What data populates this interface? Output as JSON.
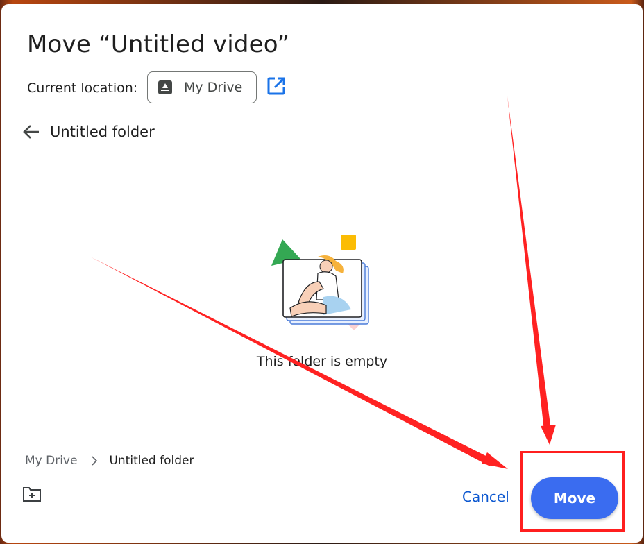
{
  "dialog": {
    "title": "Move “Untitled video”",
    "current_location_label": "Current location:",
    "current_location_value": "My Drive",
    "current_folder": "Untitled folder",
    "empty_message": "This folder is empty"
  },
  "breadcrumb": {
    "root": "My Drive",
    "current": "Untitled folder"
  },
  "actions": {
    "cancel_label": "Cancel",
    "move_label": "Move"
  },
  "icons": {
    "drive": "drive-icon",
    "open_location": "open-in-new-icon",
    "back": "arrow-back-icon",
    "chevron": "chevron-right-icon",
    "new_folder": "create-new-folder-icon"
  },
  "colors": {
    "primary": "#3a6cf0",
    "link": "#0b57d0",
    "annotation": "#ff1f1f"
  }
}
